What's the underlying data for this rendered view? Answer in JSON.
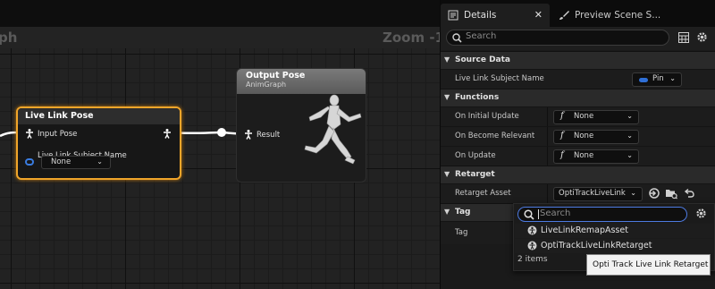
{
  "graph": {
    "name": "ph",
    "zoom": "Zoom -1",
    "nodes": {
      "live_link_pose": {
        "title": "Live Link Pose",
        "input_pose_label": "Input Pose",
        "subject_name_label": "Live Link Subject Name",
        "subject_value": "None"
      },
      "output_pose": {
        "title": "Output Pose",
        "subtitle": "AnimGraph",
        "result_label": "Result"
      }
    }
  },
  "details_panel": {
    "tabs": [
      {
        "label": "Details",
        "icon": "details-icon"
      },
      {
        "label": "Preview Scene S...",
        "icon": "paintbrush-icon"
      }
    ],
    "search_placeholder": "Search",
    "sections": {
      "source_data": {
        "title": "Source Data",
        "rows": [
          {
            "label": "Live Link Subject Name",
            "value": "Pin"
          }
        ]
      },
      "functions": {
        "title": "Functions",
        "rows": [
          {
            "label": "On Initial Update",
            "value": "None"
          },
          {
            "label": "On Become Relevant",
            "value": "None"
          },
          {
            "label": "On Update",
            "value": "None"
          }
        ]
      },
      "retarget": {
        "title": "Retarget",
        "rows": [
          {
            "label": "Retarget Asset",
            "value": "OptiTrackLiveLink"
          }
        ]
      },
      "tag": {
        "title": "Tag",
        "rows": [
          {
            "label": "Tag",
            "value": ""
          }
        ]
      }
    }
  },
  "asset_picker": {
    "search_placeholder": "Search",
    "items": [
      {
        "label": "LiveLinkRemapAsset"
      },
      {
        "label": "OptiTrackLiveLinkRetarget"
      }
    ],
    "footer": "2 items",
    "tooltip": "Opti Track Live Link Retarget"
  },
  "colors": {
    "selection_orange": "#f0a52a",
    "pin_blue": "#2f6fd6",
    "focus_blue": "#4d7ae0"
  }
}
